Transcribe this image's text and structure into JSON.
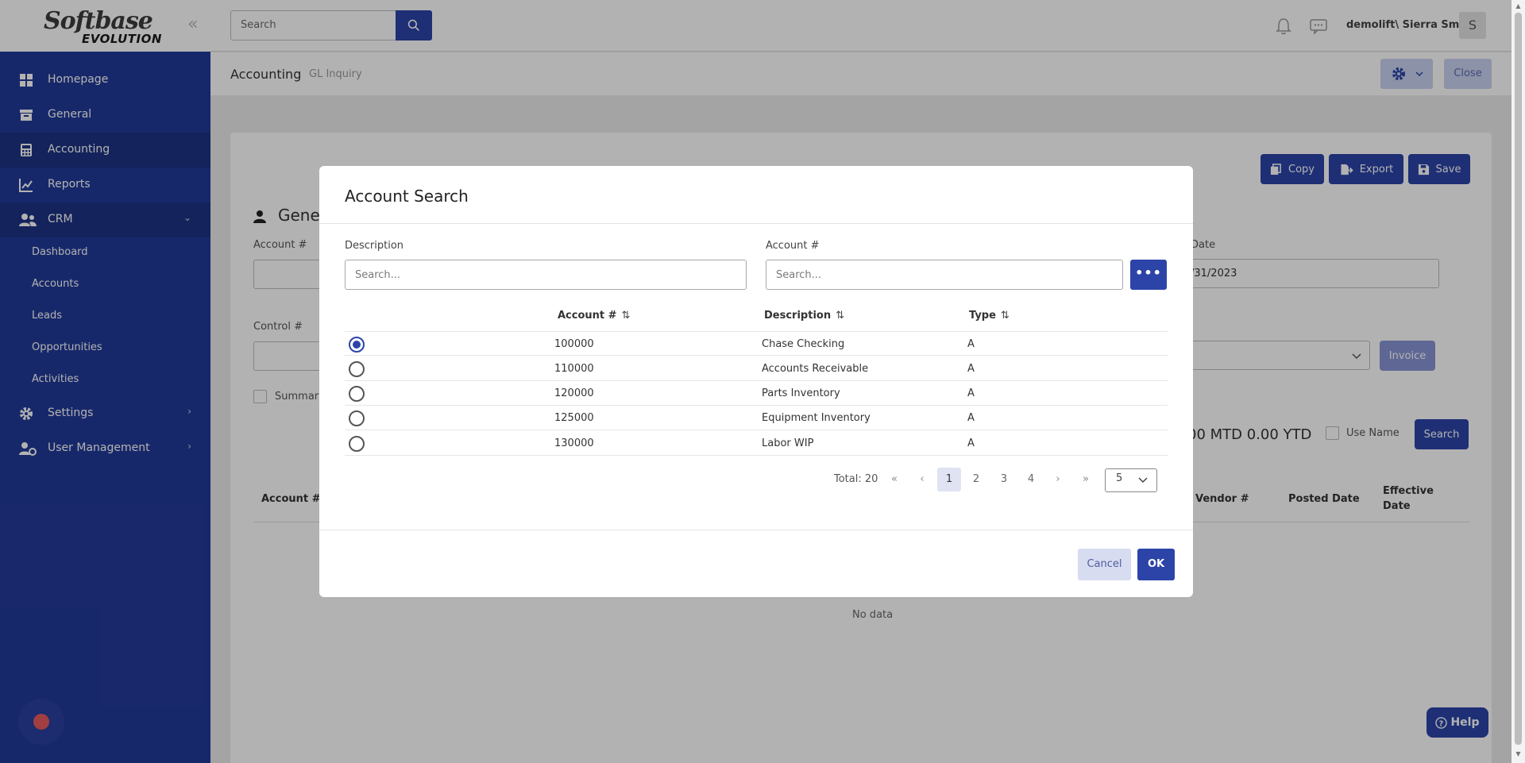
{
  "brand": {
    "logo_line1": "Softbase",
    "logo_line2": "EVOLUTION"
  },
  "topbar": {
    "search_placeholder": "Search",
    "user": "demolift\\ Sierra Smith",
    "avatar_initial": "S"
  },
  "sidebar": {
    "items": [
      {
        "label": "Homepage"
      },
      {
        "label": "General"
      },
      {
        "label": "Accounting"
      },
      {
        "label": "Reports"
      },
      {
        "label": "CRM"
      }
    ],
    "crm_sub": [
      "Dashboard",
      "Accounts",
      "Leads",
      "Opportunities",
      "Activities"
    ],
    "bottom_items": [
      {
        "label": "Settings"
      },
      {
        "label": "User Management"
      }
    ]
  },
  "breadcrumb": {
    "section": "Accounting",
    "page": "GL Inquiry"
  },
  "header_actions": {
    "close": "Close"
  },
  "toolbar": {
    "copy": "Copy",
    "export": "Export",
    "save": "Save"
  },
  "background": {
    "title": "Gener",
    "account_label": "Account #",
    "control_label": "Control #",
    "date_label": "Date",
    "date_value": "/31/2023",
    "summary_label": "Summary",
    "invoice_label": "Invoice",
    "use_name_label": "Use Name",
    "search_label": "Search",
    "totals": "00 MTD 0.00 YTD",
    "columns": [
      "Account #",
      "Vendor #",
      "Posted Date",
      "Effective",
      "Date"
    ],
    "no_data": "No data",
    "help": "Help"
  },
  "modal": {
    "title": "Account Search",
    "description_label": "Description",
    "description_placeholder": "Search...",
    "account_label": "Account #",
    "account_placeholder": "Search...",
    "columns": [
      "Account #",
      "Description",
      "Type"
    ],
    "rows": [
      {
        "account": "100000",
        "description": "Chase Checking",
        "type": "A",
        "selected": true
      },
      {
        "account": "110000",
        "description": "Accounts Receivable",
        "type": "A",
        "selected": false
      },
      {
        "account": "120000",
        "description": "Parts Inventory",
        "type": "A",
        "selected": false
      },
      {
        "account": "125000",
        "description": "Equipment Inventory",
        "type": "A",
        "selected": false
      },
      {
        "account": "130000",
        "description": "Labor WIP",
        "type": "A",
        "selected": false
      }
    ],
    "total_label": "Total: 20",
    "pages": [
      "1",
      "2",
      "3",
      "4"
    ],
    "current_page": "1",
    "page_size": "5",
    "cancel": "Cancel",
    "ok": "OK"
  },
  "colors": {
    "primary": "#2c44a8",
    "sidebar": "#223a99",
    "accent_dot": "#e75a5f"
  }
}
